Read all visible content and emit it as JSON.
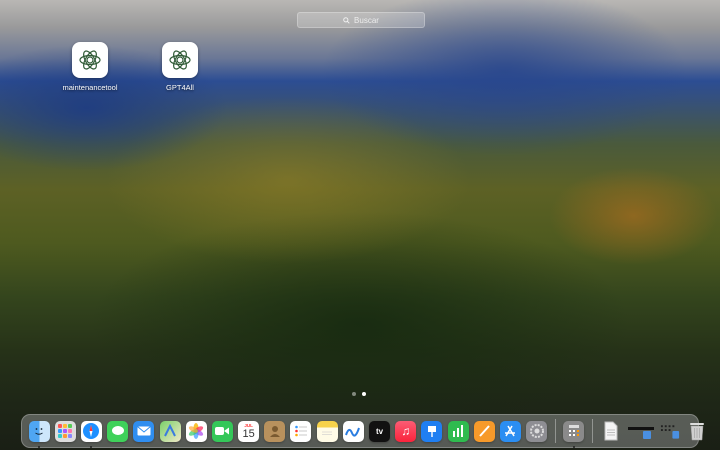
{
  "search": {
    "placeholder": "Buscar"
  },
  "apps": [
    {
      "label": "maintenancetool",
      "icon": "gpt4all-logo-icon"
    },
    {
      "label": "GPT4All",
      "icon": "gpt4all-logo-icon"
    }
  ],
  "page_indicator": {
    "count": 2,
    "current": 2
  },
  "dock": {
    "calendar": {
      "month": "JUL",
      "day": "15"
    },
    "tv_label": "tv",
    "items": [
      "Finder",
      "Launchpad",
      "Safari",
      "Messages",
      "Mail",
      "Maps",
      "Photos",
      "FaceTime",
      "Calendar",
      "Contacts",
      "Reminders",
      "Notes",
      "Freeform",
      "TV",
      "Music",
      "Keynote",
      "Numbers",
      "Pages",
      "App Store",
      "System Settings",
      "Calculator",
      "Document",
      "Folder",
      "Folder",
      "Trash"
    ]
  }
}
